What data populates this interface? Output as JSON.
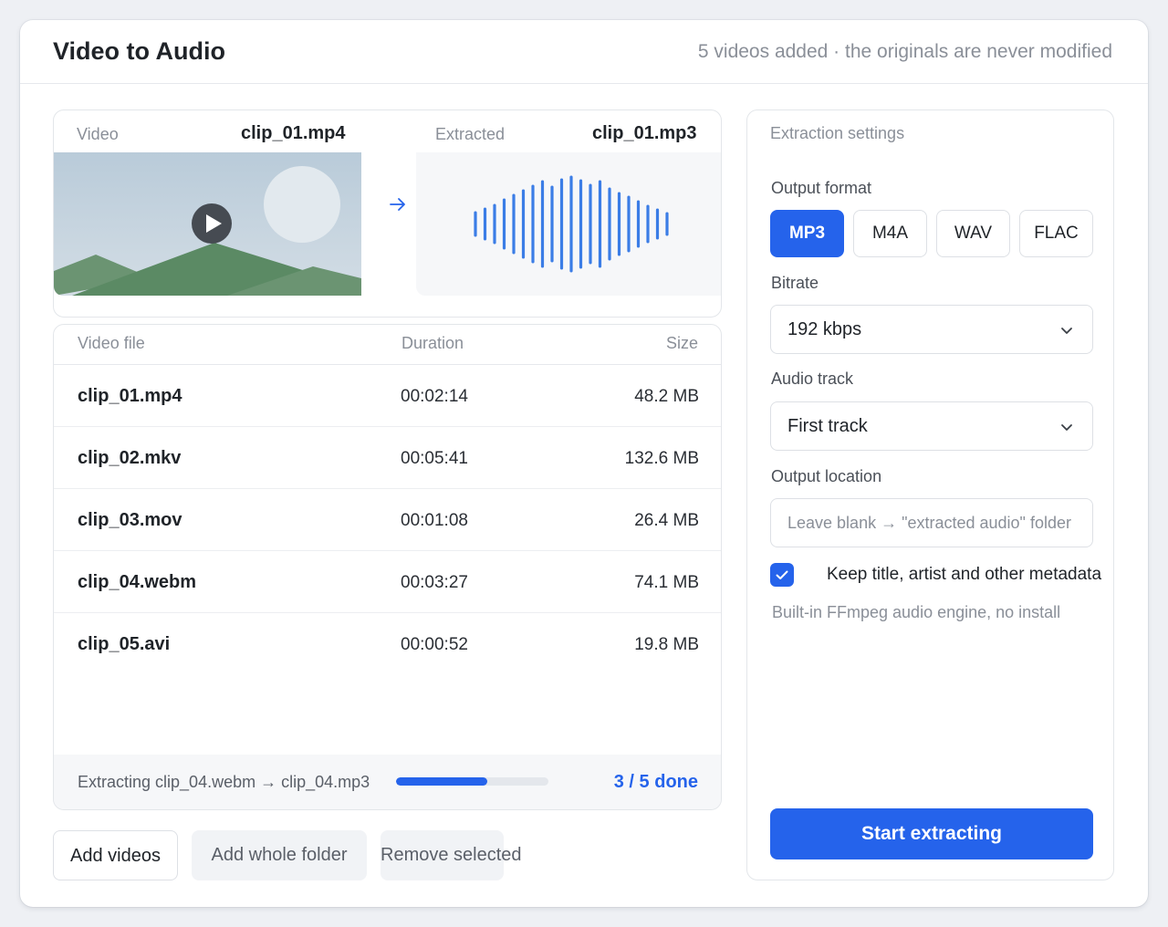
{
  "header": {
    "title": "Video to Audio",
    "status": "5 videos added · the originals are never modified"
  },
  "preview": {
    "video_label": "Video",
    "video_name": "clip_01.mp4",
    "extracted_label": "Extracted",
    "extracted_name": "clip_01.mp3",
    "icons": [
      "play-icon",
      "arrow-right-icon",
      "waveform-icon"
    ]
  },
  "table": {
    "columns": [
      "Video file",
      "Duration",
      "Size"
    ],
    "rows": [
      {
        "name": "clip_01.mp4",
        "duration": "00:02:14",
        "size": "48.2 MB"
      },
      {
        "name": "clip_02.mkv",
        "duration": "00:05:41",
        "size": "132.6 MB"
      },
      {
        "name": "clip_03.mov",
        "duration": "00:01:08",
        "size": "26.4 MB"
      },
      {
        "name": "clip_04.webm",
        "duration": "00:03:27",
        "size": "74.1 MB"
      },
      {
        "name": "clip_05.avi",
        "duration": "00:00:52",
        "size": "19.8 MB"
      }
    ]
  },
  "progress": {
    "text": "Extracting clip_04.webm → clip_04.mp3",
    "fraction": 0.6,
    "count": "3 / 5 done"
  },
  "actions": {
    "add_videos": "Add videos",
    "add_folder": "Add whole folder",
    "remove_selected": "Remove selected"
  },
  "settings": {
    "title": "Extraction settings",
    "format_label": "Output format",
    "formats": [
      "MP3",
      "M4A",
      "WAV",
      "FLAC"
    ],
    "selected_format": "MP3",
    "bitrate_label": "Bitrate",
    "bitrate_value": "192 kbps",
    "track_label": "Audio track",
    "track_value": "First track",
    "location_label": "Output location",
    "location_value": "",
    "location_placeholder": "Leave blank → \"extracted audio\" folder",
    "keep_metadata_label": "Keep title, artist and other metadata",
    "keep_metadata_checked": true,
    "engine_note": "Built-in FFmpeg audio engine, no install",
    "start_button": "Start extracting"
  },
  "colors": {
    "accent": "#2563eb",
    "wave": "#3b7de6",
    "sky": "#c4d3de",
    "hill_light": "#6b9472",
    "hill_dark": "#5b8a64"
  }
}
